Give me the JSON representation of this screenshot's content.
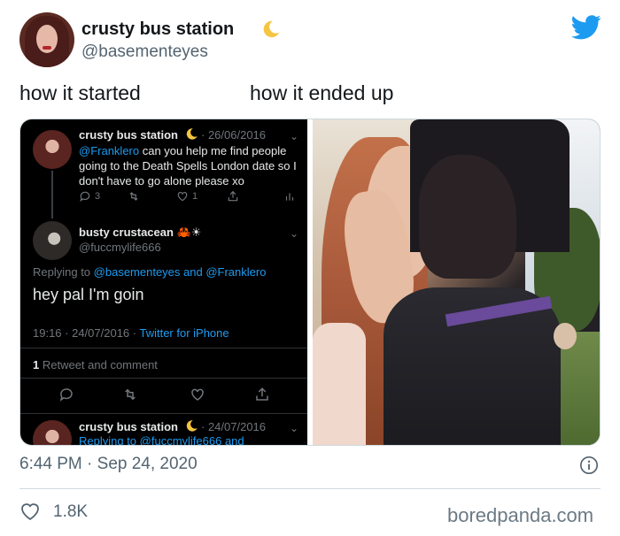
{
  "tweet": {
    "display_name": "crusty bus station",
    "handle": "@basementeyes",
    "icons": [
      "crescent-moon-icon",
      "twitter-bird-icon",
      "info-icon",
      "heart-icon"
    ],
    "timestamp": "6:44 PM · Sep 24, 2020",
    "likes": "1.8K",
    "accent_color": "#1d9bf0"
  },
  "captions": {
    "left": "how it started",
    "right": "how it ended up"
  },
  "screenshot": {
    "tweet1": {
      "name": "crusty bus station",
      "meta": "· 26/06/2016",
      "mention": "@Franklero",
      "text": " can you help me find people going to the Death Spells London date so I don't have to go alone please xo",
      "reply_count": "3",
      "like_count": "1"
    },
    "tweet2": {
      "name": "busty crustacean 🦀☀",
      "handle": "@fuccmylife666",
      "replying_prefix": "Replying to ",
      "replying_users": "@basementeyes and @Franklero",
      "text": "hey pal I'm goin",
      "time": "19:16 · 24/07/2016 · ",
      "client": "Twitter for iPhone",
      "retweet_count": "1",
      "retweet_label": " Retweet and comment"
    },
    "tweet3": {
      "name": "crusty bus station",
      "meta": "· 24/07/2016",
      "replying": "Replying to @fuccmylife666 and"
    }
  },
  "watermark": "boredpanda.com"
}
